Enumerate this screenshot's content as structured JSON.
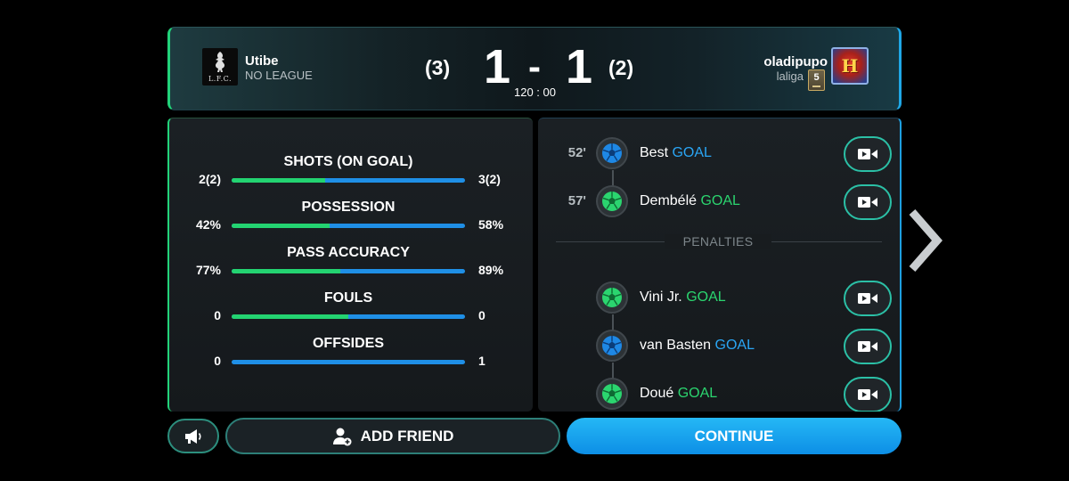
{
  "header": {
    "home": {
      "name": "Utibe",
      "league": "NO LEAGUE",
      "crest_text": "L.F.C."
    },
    "away": {
      "name": "oladipupo",
      "league": "laliga",
      "level": "5",
      "crest_text": "H"
    },
    "score": {
      "home_pen": "(3)",
      "home_goals": "1",
      "separator": "-",
      "away_goals": "1",
      "away_pen": "(2)",
      "clock": "120 : 00"
    }
  },
  "stats": [
    {
      "title": "SHOTS (ON GOAL)",
      "home": "2(2)",
      "away": "3(2)",
      "home_share": 0.4
    },
    {
      "title": "POSSESSION",
      "home": "42%",
      "away": "58%",
      "home_share": 0.42
    },
    {
      "title": "PASS ACCURACY",
      "home": "77%",
      "away": "89%",
      "home_share": 0.4639
    },
    {
      "title": "FOULS",
      "home": "0",
      "away": "0",
      "home_share": 0.5
    },
    {
      "title": "OFFSIDES",
      "home": "0",
      "away": "1",
      "home_share": 0.0
    }
  ],
  "events": {
    "goals": [
      {
        "minute": "52'",
        "player": "Best",
        "label": "GOAL",
        "team": "away"
      },
      {
        "minute": "57'",
        "player": "Dembélé",
        "label": "GOAL",
        "team": "home"
      }
    ],
    "penalties_label": "PENALTIES",
    "penalties": [
      {
        "player": "Vini Jr.",
        "label": "GOAL",
        "team": "home"
      },
      {
        "player": "van Basten",
        "label": "GOAL",
        "team": "away"
      },
      {
        "player": "Doué",
        "label": "GOAL",
        "team": "home"
      }
    ]
  },
  "buttons": {
    "megaphone_icon": "megaphone-icon",
    "add_friend": "ADD FRIEND",
    "add_friend_icon": "add-user-icon",
    "continue": "CONTINUE",
    "next_icon": "chevron-right-icon"
  },
  "colors": {
    "home_accent": "#23d371",
    "away_accent": "#1f8fe6",
    "continue_button": "#1aa6ef",
    "panel_bg": "#181c1f"
  }
}
